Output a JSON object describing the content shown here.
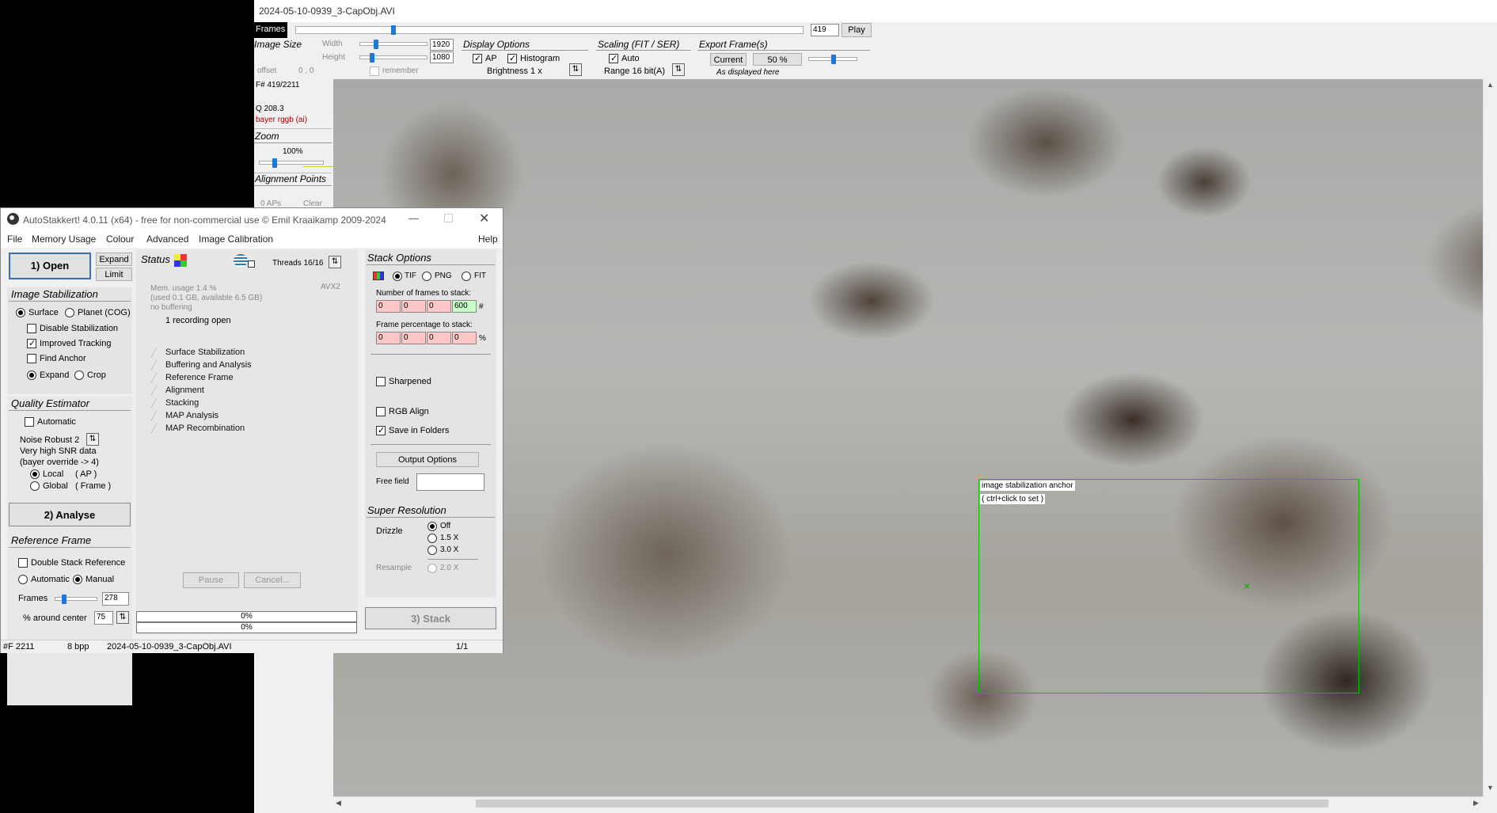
{
  "viewer": {
    "title": "2024-05-10-0939_3-CapObj.AVI",
    "frames_label": "Frames",
    "frame_number": "419",
    "play_label": "Play",
    "image_size": {
      "head": "Image Size",
      "width_label": "Width",
      "height_label": "Height",
      "width_value": "1920",
      "height_value": "1080",
      "offset_label": "offset",
      "offset_value": "0 , 0",
      "remember_label": "remember"
    },
    "display_options": {
      "head": "Display Options",
      "ap_label": "AP",
      "histogram_label": "Histogram",
      "brightness_label": "Brightness  1 x"
    },
    "scaling": {
      "head": "Scaling (FIT / SER)",
      "auto_label": "Auto",
      "range_label": "Range 16 bit(A)"
    },
    "export": {
      "head": "Export Frame(s)",
      "current_label": "Current",
      "percent_label": "50 %",
      "as_displayed": "As displayed here"
    },
    "info": {
      "frame_index": "F# 419/2211",
      "quality": "Q  208.3",
      "bayer": "bayer rggb (ai)"
    },
    "zoom": {
      "head": "Zoom",
      "value": "100%"
    },
    "alignment_points": {
      "head": "Alignment Points",
      "count": "0 APs",
      "clear_label": "Clear"
    },
    "anchor_label": "image stabilization anchor",
    "anchor_hint": "( ctrl+click to set )",
    "anchor_marker": "×"
  },
  "as": {
    "title": "AutoStakkert! 4.0.11 (x64) - free for non-commercial use © Emil Kraaikamp 2009-2024",
    "menu": [
      "File",
      "Memory Usage",
      "Colour",
      "Advanced",
      "Image Calibration",
      "Help"
    ],
    "open_label": "1) Open",
    "expand_label": "Expand",
    "limit_label": "Limit",
    "stabilization": {
      "head": "Image Stabilization",
      "surface": "Surface",
      "planet": "Planet (COG)",
      "disable": "Disable Stabilization",
      "improved": "Improved Tracking",
      "find_anchor": "Find Anchor",
      "expand": "Expand",
      "crop": "Crop"
    },
    "quality": {
      "head": "Quality Estimator",
      "automatic": "Automatic",
      "noise": "Noise Robust  2",
      "snr": "Very high SNR data",
      "bayer": "(bayer override -> 4)",
      "local": "Local",
      "local_sub": "( AP )",
      "global": "Global",
      "global_sub": "( Frame )"
    },
    "analyse_label": "2) Analyse",
    "reference": {
      "head": "Reference Frame",
      "double": "Double Stack Reference",
      "automatic": "Automatic",
      "manual": "Manual",
      "frames_label": "Frames",
      "frames_value": "278",
      "around_label": "% around center",
      "around_value": "75"
    },
    "status": {
      "head": "Status",
      "threads": "Threads 16/16",
      "mem1": "Mem. usage 1.4 %",
      "mem2": "(used 0.1 GB, available 6.5 GB)",
      "mem3": "no buffering",
      "avx": "AVX2",
      "recording": "1 recording open",
      "steps": [
        "Surface Stabilization",
        "Buffering and Analysis",
        "Reference Frame",
        "Alignment",
        "Stacking",
        "MAP Analysis",
        "MAP Recombination"
      ],
      "pause_label": "Pause",
      "cancel_label": "Cancel...",
      "progress1": "0%",
      "progress2": "0%"
    },
    "stack": {
      "head": "Stack Options",
      "tif": "TIF",
      "png": "PNG",
      "fit": "FIT",
      "frames_head": "Number of frames to stack:",
      "frames_values": [
        "0",
        "0",
        "0",
        "600"
      ],
      "frames_unit": "#",
      "pct_head": "Frame percentage to stack:",
      "pct_values": [
        "0",
        "0",
        "0",
        "0"
      ],
      "pct_unit": "%",
      "sharpened": "Sharpened",
      "rgb_align": "RGB Align",
      "save_folders": "Save in Folders",
      "output_options": "Output Options",
      "free_field": "Free field"
    },
    "super": {
      "head": "Super Resolution",
      "drizzle": "Drizzle",
      "off": "Off",
      "x15": "1.5 X",
      "x30": "3.0 X",
      "resample": "Resample",
      "x20": "2.0 X"
    },
    "stack_label": "3) Stack",
    "statusbar": {
      "frames": "#F 2211",
      "bpp": "8 bpp",
      "file": "2024-05-10-0939_3-CapObj.AVI",
      "page": "1/1"
    }
  }
}
